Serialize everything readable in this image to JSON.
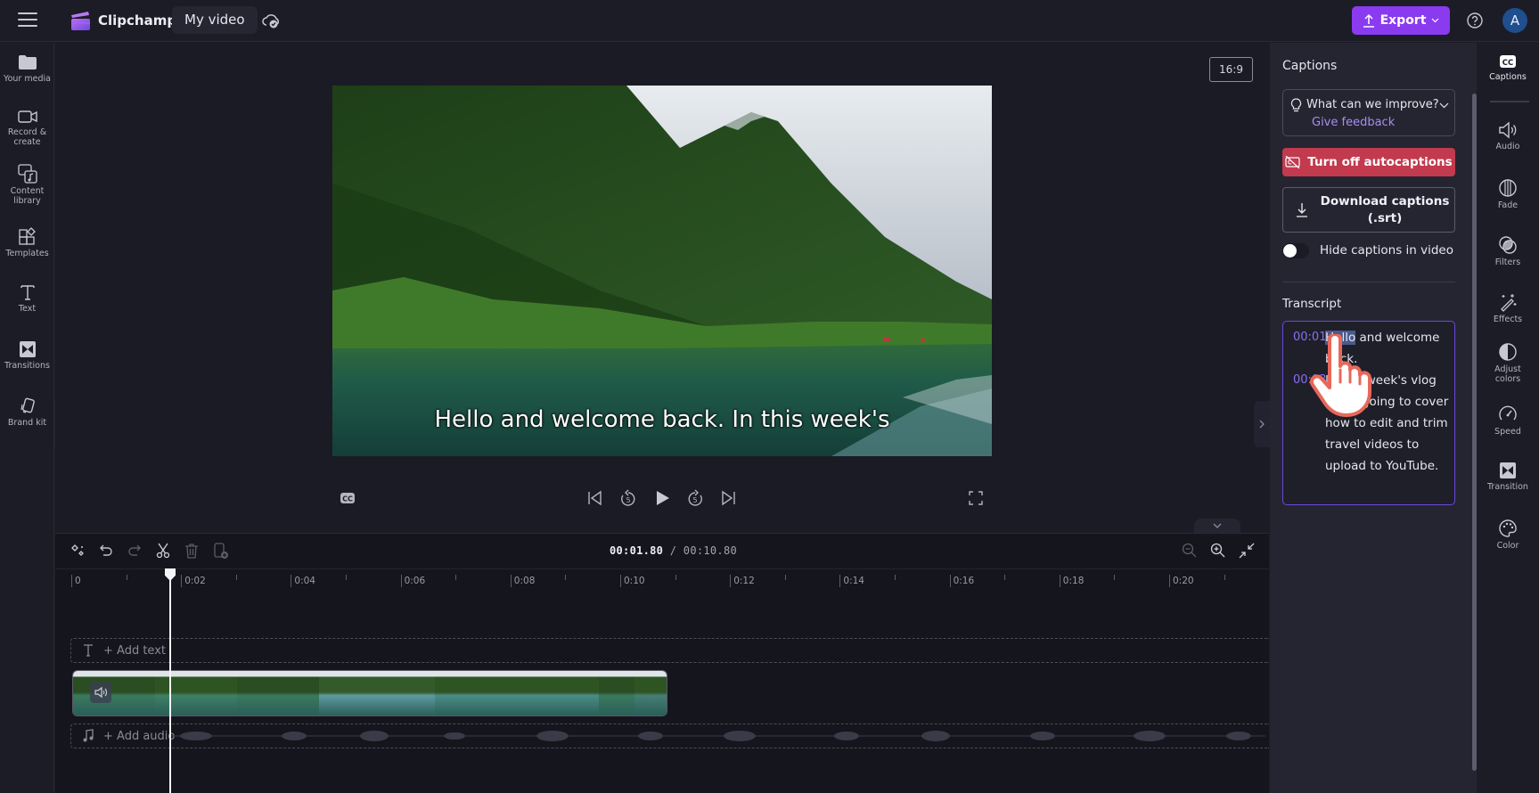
{
  "app": {
    "brand": "Clipchamp",
    "project_title": "My video",
    "export_label": "Export",
    "avatar_initial": "A",
    "colors": {
      "accent": "#8a3bf0",
      "danger": "#c23a4e",
      "link": "#a98cf0",
      "timestamp": "#8a6ef0"
    }
  },
  "left_sidebar": {
    "items": [
      {
        "id": "your-media",
        "label": "Your media",
        "icon": "folder-icon"
      },
      {
        "id": "record-create",
        "label": "Record & create",
        "icon": "camera-icon"
      },
      {
        "id": "content-library",
        "label": "Content library",
        "icon": "library-icon"
      },
      {
        "id": "templates",
        "label": "Templates",
        "icon": "templates-icon"
      },
      {
        "id": "text",
        "label": "Text",
        "icon": "text-icon"
      },
      {
        "id": "transitions",
        "label": "Transitions",
        "icon": "transitions-icon"
      },
      {
        "id": "brand-kit",
        "label": "Brand kit",
        "icon": "brand-kit-icon"
      }
    ]
  },
  "preview": {
    "aspect_ratio": "16:9",
    "caption_text": "Hello and welcome back. In this week's"
  },
  "timeline": {
    "current_time": "00:01.80",
    "separator": "/",
    "total_time": "00:10.80",
    "ruler_labels": [
      "0",
      "0:02",
      "0:04",
      "0:06",
      "0:08",
      "0:10",
      "0:12",
      "0:14",
      "0:16",
      "0:18",
      "0:20"
    ],
    "add_text_label": "+ Add text",
    "add_audio_label": "+ Add audio",
    "playhead_seconds": 1.8
  },
  "captions_panel": {
    "title": "Captions",
    "feedback_question": "What can we improve?",
    "feedback_link": "Give feedback",
    "turn_off_label": "Turn off autocaptions",
    "download_label_line1": "Download captions",
    "download_label_line2": "(.srt)",
    "hide_toggle_label": "Hide captions in video",
    "hide_toggle_on": false,
    "transcript_title": "Transcript",
    "transcript": [
      {
        "time": "00:01",
        "highlight": "Hello",
        "rest": " and welcome back."
      },
      {
        "time": "00:03",
        "text": "In this week's vlog we're going to cover how to edit and trim travel videos to upload to YouTube."
      }
    ]
  },
  "right_rail": {
    "items": [
      {
        "id": "captions",
        "label": "Captions",
        "icon": "cc-icon",
        "active": true
      },
      {
        "id": "audio",
        "label": "Audio",
        "icon": "speaker-icon"
      },
      {
        "id": "fade",
        "label": "Fade",
        "icon": "fade-icon"
      },
      {
        "id": "filters",
        "label": "Filters",
        "icon": "filters-icon"
      },
      {
        "id": "effects",
        "label": "Effects",
        "icon": "magic-wand-icon"
      },
      {
        "id": "adjust-colors",
        "label": "Adjust colors",
        "icon": "contrast-icon"
      },
      {
        "id": "speed",
        "label": "Speed",
        "icon": "speedometer-icon"
      },
      {
        "id": "transition",
        "label": "Transition",
        "icon": "transition-icon"
      },
      {
        "id": "color",
        "label": "Color",
        "icon": "palette-icon"
      }
    ]
  }
}
